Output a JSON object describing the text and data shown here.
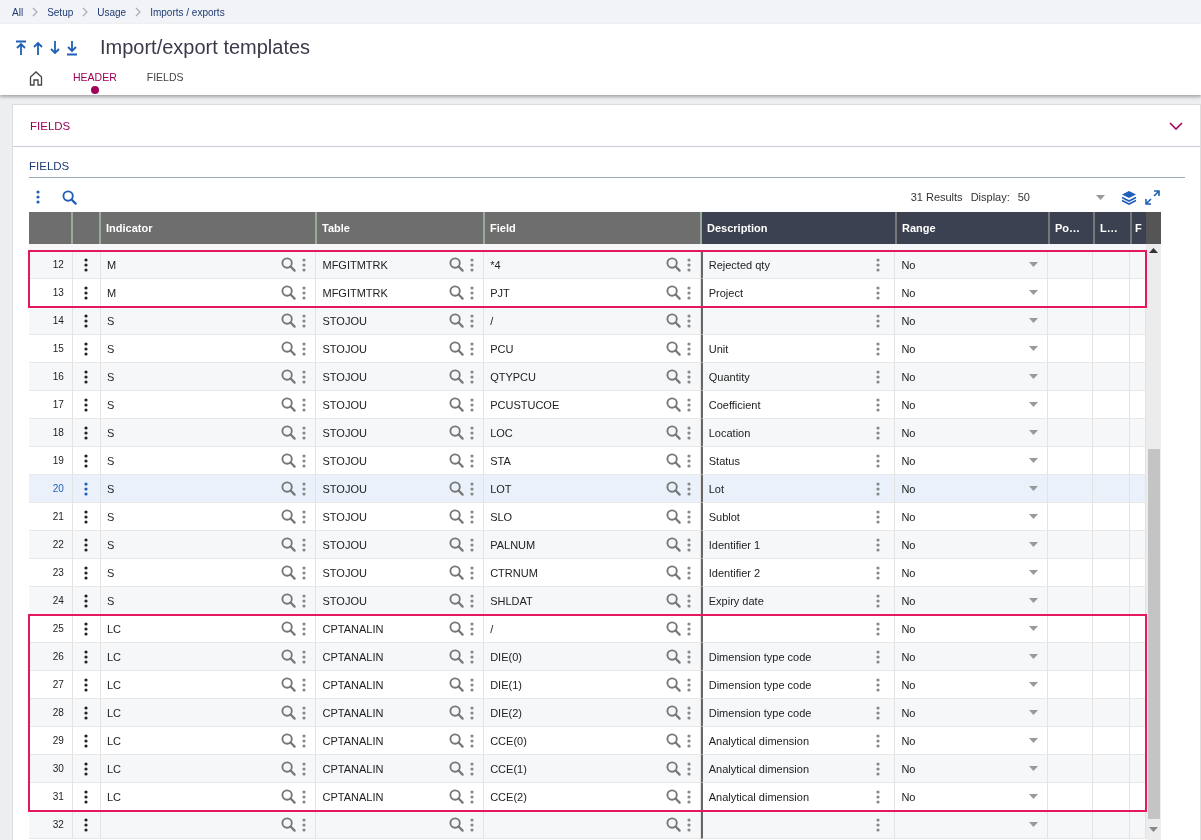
{
  "breadcrumb": [
    "All",
    "Setup",
    "Usage",
    "Imports / exports"
  ],
  "title": "Import/export templates",
  "tabs": [
    {
      "label": "HEADER",
      "selected": true
    },
    {
      "label": "FIELDS",
      "selected": false
    }
  ],
  "section": {
    "title": "FIELDS",
    "expanded": false
  },
  "grid": {
    "title": "FIELDS",
    "results": "31 Results",
    "display_label": "Display:",
    "display_value": "50",
    "columns": [
      "Indicator",
      "Table",
      "Field",
      "Description",
      "Range",
      "Po…",
      "L…",
      "F"
    ],
    "row_groups": [
      {
        "outlined": true,
        "rows": [
          {
            "number": "12",
            "indicator": "M",
            "table": "MFGITMTRK",
            "field": "*4",
            "description": "Rejected qty",
            "range": "No",
            "selected": false
          },
          {
            "number": "13",
            "indicator": "M",
            "table": "MFGITMTRK",
            "field": "PJT",
            "description": "Project",
            "range": "No",
            "selected": false
          }
        ]
      },
      {
        "outlined": false,
        "rows": [
          {
            "number": "14",
            "indicator": "S",
            "table": "STOJOU",
            "field": "/",
            "range": "No",
            "selected": false
          },
          {
            "number": "15",
            "indicator": "S",
            "table": "STOJOU",
            "field": "PCU",
            "description": "Unit",
            "range": "No",
            "selected": false
          },
          {
            "number": "16",
            "indicator": "S",
            "table": "STOJOU",
            "field": "QTYPCU",
            "description": "Quantity",
            "range": "No",
            "selected": false
          },
          {
            "number": "17",
            "indicator": "S",
            "table": "STOJOU",
            "field": "PCUSTUCOE",
            "description": "Coefficient",
            "range": "No",
            "selected": false
          },
          {
            "number": "18",
            "indicator": "S",
            "table": "STOJOU",
            "field": "LOC",
            "description": "Location",
            "range": "No",
            "selected": false
          },
          {
            "number": "19",
            "indicator": "S",
            "table": "STOJOU",
            "field": "STA",
            "description": "Status",
            "range": "No",
            "selected": false
          },
          {
            "number": "20",
            "indicator": "S",
            "table": "STOJOU",
            "field": "LOT",
            "description": "Lot",
            "range": "No",
            "selected": true
          },
          {
            "number": "21",
            "indicator": "S",
            "table": "STOJOU",
            "field": "SLO",
            "description": "Sublot",
            "range": "No",
            "selected": false
          },
          {
            "number": "22",
            "indicator": "S",
            "table": "STOJOU",
            "field": "PALNUM",
            "description": "Identifier 1",
            "range": "No",
            "selected": false
          },
          {
            "number": "23",
            "indicator": "S",
            "table": "STOJOU",
            "field": "CTRNUM",
            "description": "Identifier 2",
            "range": "No",
            "selected": false
          },
          {
            "number": "24",
            "indicator": "S",
            "table": "STOJOU",
            "field": "SHLDAT",
            "description": "Expiry date",
            "range": "No",
            "selected": false
          }
        ]
      },
      {
        "outlined": true,
        "rows": [
          {
            "number": "25",
            "indicator": "LC",
            "table": "CPTANALIN",
            "field": "/",
            "range": "No",
            "selected": false
          },
          {
            "number": "26",
            "indicator": "LC",
            "table": "CPTANALIN",
            "field": "DIE(0)",
            "description": "Dimension type code",
            "range": "No",
            "selected": false
          },
          {
            "number": "27",
            "indicator": "LC",
            "table": "CPTANALIN",
            "field": "DIE(1)",
            "description": "Dimension type code",
            "range": "No",
            "selected": false
          },
          {
            "number": "28",
            "indicator": "LC",
            "table": "CPTANALIN",
            "field": "DIE(2)",
            "description": "Dimension type code",
            "range": "No",
            "selected": false
          },
          {
            "number": "29",
            "indicator": "LC",
            "table": "CPTANALIN",
            "field": "CCE(0)",
            "description": "Analytical dimension",
            "range": "No",
            "selected": false
          },
          {
            "number": "30",
            "indicator": "LC",
            "table": "CPTANALIN",
            "field": "CCE(1)",
            "description": "Analytical dimension",
            "range": "No",
            "selected": false
          },
          {
            "number": "31",
            "indicator": "LC",
            "table": "CPTANALIN",
            "field": "CCE(2)",
            "description": "Analytical dimension",
            "range": "No",
            "selected": false
          }
        ]
      },
      {
        "outlined": false,
        "rows": [
          {
            "number": "32",
            "selected": false
          }
        ]
      }
    ]
  }
}
